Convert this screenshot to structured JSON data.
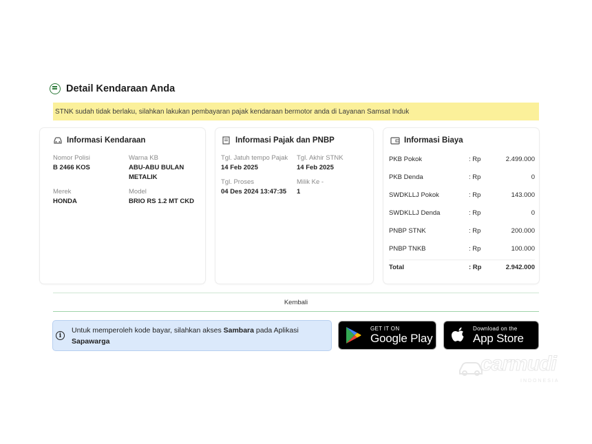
{
  "section": {
    "title": "Detail Kendaraan Anda",
    "alert": "STNK sudah tidak berlaku, silahkan lakukan pembayaran pajak kendaraan bermotor anda di Layanan Samsat Induk"
  },
  "vehicle_card": {
    "title": "Informasi Kendaraan",
    "fields": [
      {
        "label": "Nomor Polisi",
        "value": "B 2466 KOS"
      },
      {
        "label": "Warna KB",
        "value": "ABU-ABU BULAN METALIK"
      },
      {
        "label": "Merek",
        "value": "HONDA"
      },
      {
        "label": "Model",
        "value": "BRIO RS 1.2 MT CKD"
      }
    ]
  },
  "tax_card": {
    "title": "Informasi Pajak dan PNBP",
    "fields": [
      {
        "label": "Tgl. Jatuh tempo Pajak",
        "value": "14 Feb 2025"
      },
      {
        "label": "Tgl. Akhir STNK",
        "value": "14 Feb 2025"
      },
      {
        "label": "Tgl. Proses",
        "value": "04 Des 2024 13:47:35"
      },
      {
        "label": "Milik Ke -",
        "value": "1"
      }
    ]
  },
  "cost_card": {
    "title": "Informasi Biaya",
    "currency": ": Rp",
    "rows": [
      {
        "name": "PKB Pokok",
        "amount": "2.499.000"
      },
      {
        "name": "PKB Denda",
        "amount": "0"
      },
      {
        "name": "SWDKLLJ Pokok",
        "amount": "143.000"
      },
      {
        "name": "SWDKLLJ Denda",
        "amount": "0"
      },
      {
        "name": "PNBP STNK",
        "amount": "200.000"
      },
      {
        "name": "PNBP TNKB",
        "amount": "100.000"
      }
    ],
    "total": {
      "name": "Total",
      "amount": "2.942.000"
    }
  },
  "back_button": "Kembali",
  "info": {
    "prefix": "Untuk memperoleh kode bayar, silahkan akses ",
    "app_bold": "Sambara",
    "middle": " pada Aplikasi ",
    "app2_bold": "Sapawarga"
  },
  "stores": {
    "google": {
      "small": "GET IT ON",
      "big": "Google Play"
    },
    "apple": {
      "small": "Download on the",
      "big": "App Store"
    }
  },
  "watermark": {
    "brand": "carmudi",
    "sub": "INDONESIA"
  },
  "colors": {
    "alert_bg": "#fbf09a",
    "accent_green": "#2d7a3a",
    "info_bg": "#dbe9fb"
  }
}
